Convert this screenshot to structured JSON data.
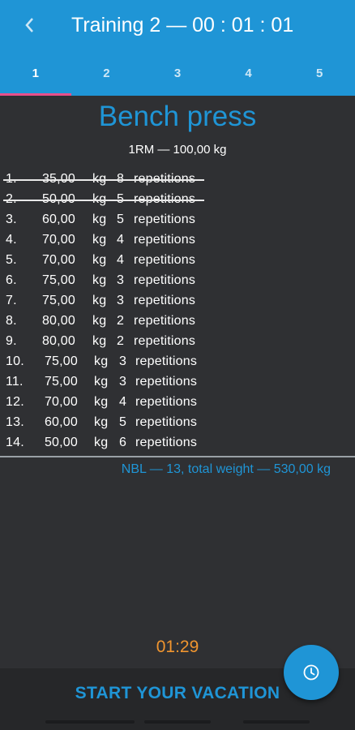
{
  "header": {
    "title": "Training 2 — 00 : 01 : 01",
    "back_icon": "chevron-left-icon"
  },
  "tabs": [
    {
      "label": "1",
      "active": true
    },
    {
      "label": "2",
      "active": false
    },
    {
      "label": "3",
      "active": false
    },
    {
      "label": "4",
      "active": false
    },
    {
      "label": "5",
      "active": false
    }
  ],
  "exercise": {
    "name": "Bench press",
    "one_rm": "1RM — 100,00 kg"
  },
  "sets": [
    {
      "num": "1.",
      "weight": "35,00",
      "unit": "kg",
      "reps": "8",
      "label": "repetitions",
      "done": true
    },
    {
      "num": "2.",
      "weight": "50,00",
      "unit": "kg",
      "reps": "5",
      "label": "repetitions",
      "done": true
    },
    {
      "num": "3.",
      "weight": "60,00",
      "unit": "kg",
      "reps": "5",
      "label": "repetitions",
      "done": false
    },
    {
      "num": "4.",
      "weight": "70,00",
      "unit": "kg",
      "reps": "4",
      "label": "repetitions",
      "done": false
    },
    {
      "num": "5.",
      "weight": "70,00",
      "unit": "kg",
      "reps": "4",
      "label": "repetitions",
      "done": false
    },
    {
      "num": "6.",
      "weight": "75,00",
      "unit": "kg",
      "reps": "3",
      "label": "repetitions",
      "done": false
    },
    {
      "num": "7.",
      "weight": "75,00",
      "unit": "kg",
      "reps": "3",
      "label": "repetitions",
      "done": false
    },
    {
      "num": "8.",
      "weight": "80,00",
      "unit": "kg",
      "reps": "2",
      "label": "repetitions",
      "done": false
    },
    {
      "num": "9.",
      "weight": "80,00",
      "unit": "kg",
      "reps": "2",
      "label": "repetitions",
      "done": false
    },
    {
      "num": "10.",
      "weight": "75,00",
      "unit": "kg",
      "reps": "3",
      "label": "repetitions",
      "done": false
    },
    {
      "num": "11.",
      "weight": "75,00",
      "unit": "kg",
      "reps": "3",
      "label": "repetitions",
      "done": false
    },
    {
      "num": "12.",
      "weight": "70,00",
      "unit": "kg",
      "reps": "4",
      "label": "repetitions",
      "done": false
    },
    {
      "num": "13.",
      "weight": "60,00",
      "unit": "kg",
      "reps": "5",
      "label": "repetitions",
      "done": false
    },
    {
      "num": "14.",
      "weight": "50,00",
      "unit": "kg",
      "reps": "6",
      "label": "repetitions",
      "done": false
    }
  ],
  "summary": "NBL — 13, total weight — 530,00 kg",
  "timer": "01:29",
  "action": {
    "label": "START YOUR VACATION",
    "fab_icon": "clock-icon"
  },
  "colors": {
    "primary": "#1f95d6",
    "background": "#2f3033",
    "accent_timer": "#f0952f",
    "tab_indicator": "#e94f8a"
  }
}
